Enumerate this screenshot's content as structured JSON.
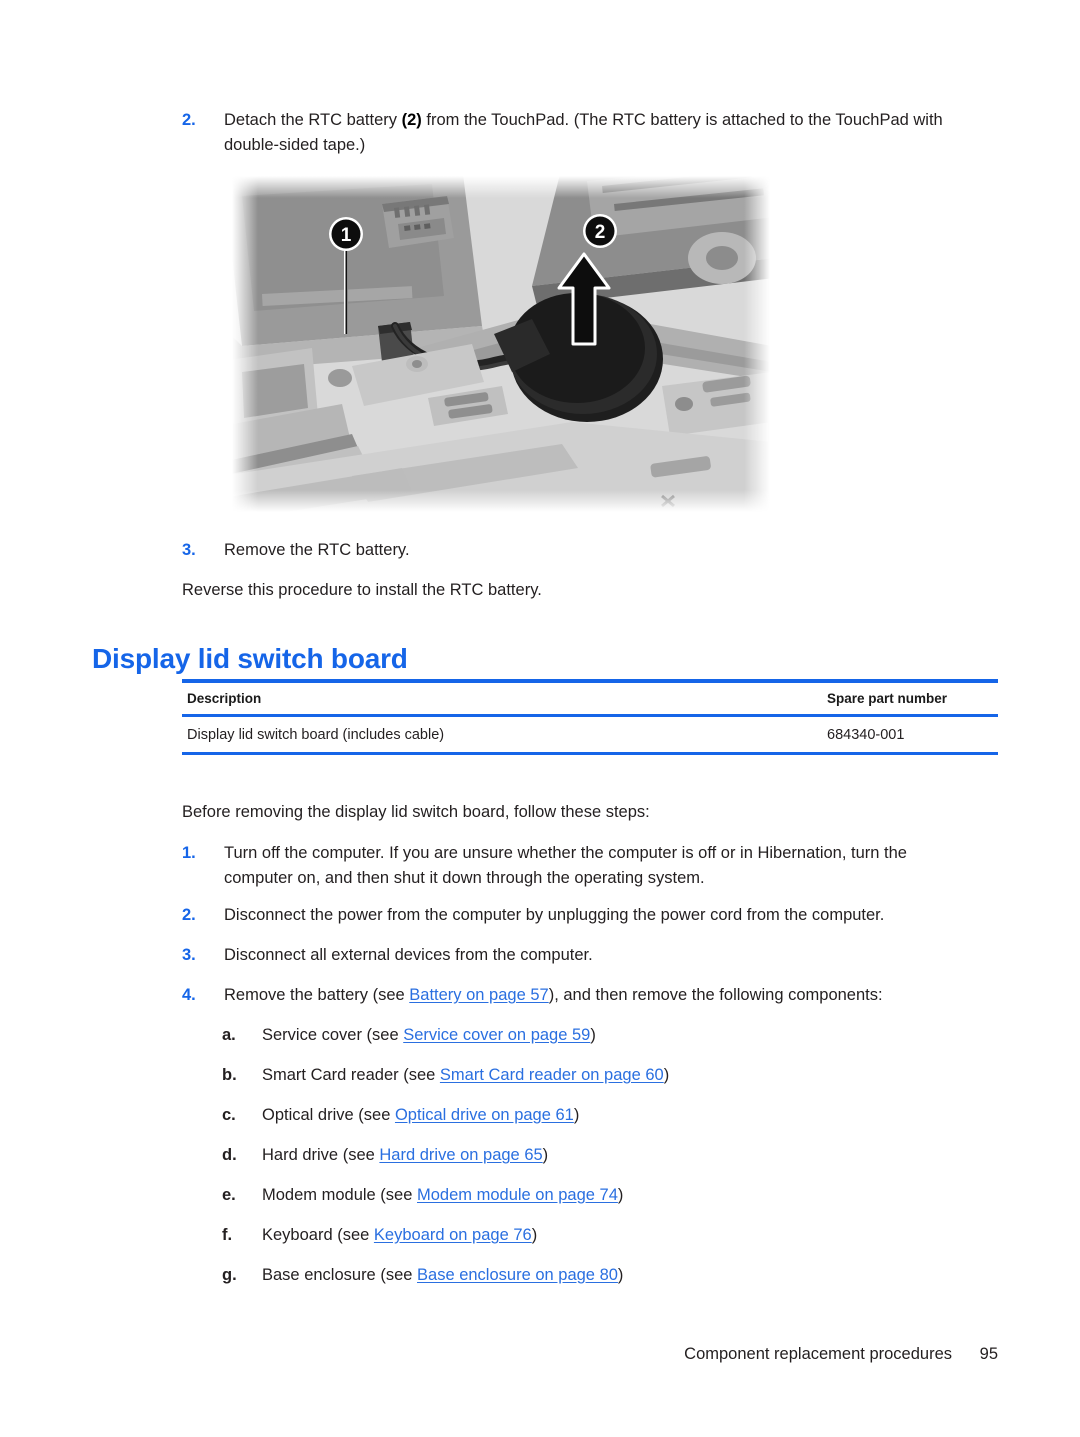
{
  "document": {
    "page_number": "95",
    "footer_title": "Component replacement procedures"
  },
  "steps_top": [
    {
      "marker": "2.",
      "text_before": "Detach the RTC battery ",
      "bold": "(2)",
      "text_after": " from the TouchPad. (The RTC battery is attached to the TouchPad with double-sided tape.)"
    },
    {
      "marker": "3.",
      "text": "Remove the RTC battery."
    }
  ],
  "reverse_note": "Reverse this procedure to install the RTC battery.",
  "figure": {
    "alt": "Grayscale photo of laptop internals showing RTC battery cable and battery",
    "callout_1": "1",
    "callout_2": "2"
  },
  "heading": "Display lid switch board",
  "table": {
    "headers": [
      "Description",
      "Spare part number"
    ],
    "rows": [
      [
        "Display lid switch board (includes cable)",
        "684340-001"
      ]
    ]
  },
  "intro": "Before removing the display lid switch board, follow these steps:",
  "steps": [
    {
      "marker": "1.",
      "text": "Turn off the computer. If you are unsure whether the computer is off or in Hibernation, turn the computer on, and then shut it down through the operating system."
    },
    {
      "marker": "2.",
      "text": "Disconnect the power from the computer by unplugging the power cord from the computer."
    },
    {
      "marker": "3.",
      "text": "Disconnect all external devices from the computer."
    },
    {
      "marker": "4.",
      "prefix": "Remove the battery (see ",
      "link": "Battery on page 57",
      "suffix": "), and then remove the following components:"
    }
  ],
  "substeps": [
    {
      "marker": "a.",
      "prefix": "Service cover (see ",
      "link": "Service cover on page 59",
      "suffix": ")"
    },
    {
      "marker": "b.",
      "prefix": "Smart Card reader (see ",
      "link": "Smart Card reader on page 60",
      "suffix": ")"
    },
    {
      "marker": "c.",
      "prefix": "Optical drive (see ",
      "link": "Optical drive on page 61",
      "suffix": ")"
    },
    {
      "marker": "d.",
      "prefix": "Hard drive (see ",
      "link": "Hard drive on page 65",
      "suffix": ")"
    },
    {
      "marker": "e.",
      "prefix": "Modem module (see ",
      "link": "Modem module on page 74",
      "suffix": ")"
    },
    {
      "marker": "f.",
      "prefix": "Keyboard (see ",
      "link": "Keyboard on page 76",
      "suffix": ")"
    },
    {
      "marker": "g.",
      "prefix": "Base enclosure (see ",
      "link": "Base enclosure on page 80",
      "suffix": ")"
    }
  ],
  "colors": {
    "accent_blue": "#1565E8",
    "link_blue": "#2A6FE0",
    "text": "#231f20"
  }
}
